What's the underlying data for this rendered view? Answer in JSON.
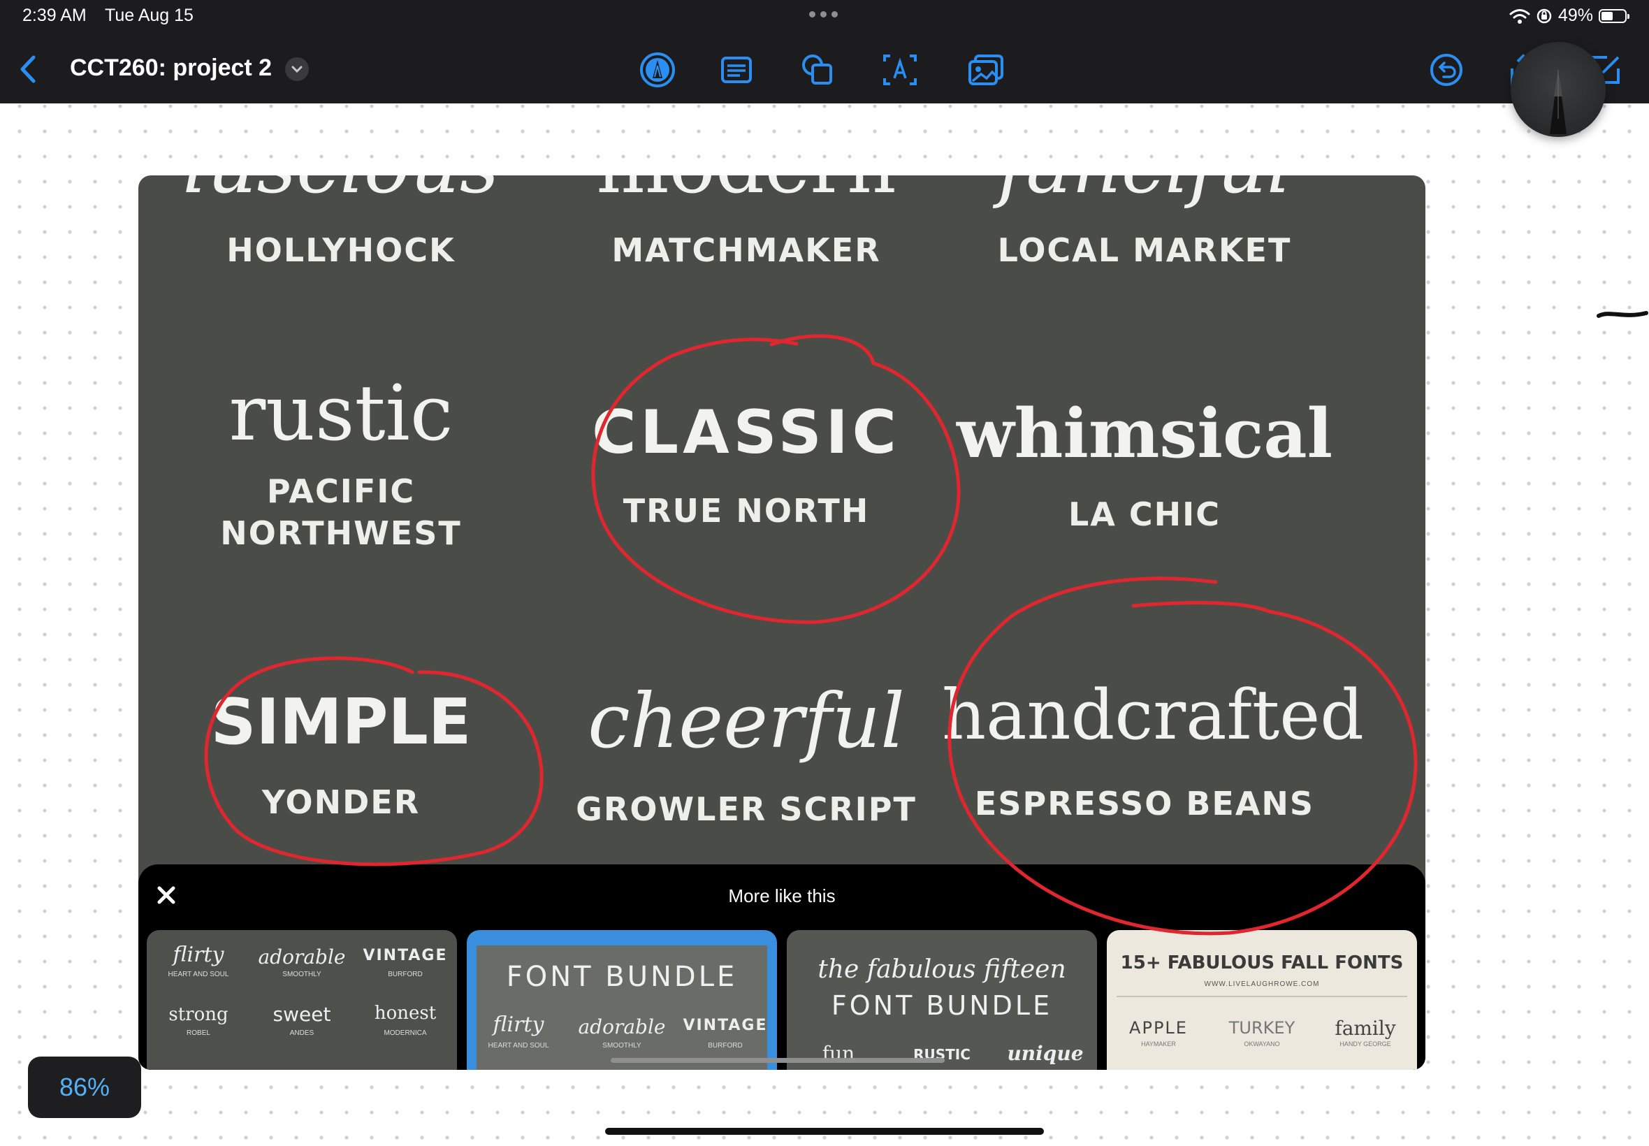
{
  "status_bar": {
    "time": "2:39 AM",
    "date": "Tue Aug 15",
    "battery": "49%",
    "battery_level": 0.49
  },
  "toolbar": {
    "title": "CCT260: project 2",
    "tools": [
      "pen-tool-icon",
      "text-box-icon",
      "shapes-icon",
      "text-recognition-icon",
      "insert-image-icon"
    ],
    "accent": "#2a8ef2"
  },
  "image": {
    "top_row": [
      {
        "script": "luscious",
        "font": "HOLLYHOCK"
      },
      {
        "script": "modern",
        "font": "MATCHMAKER"
      },
      {
        "script": "fanciful",
        "font": "LOCAL MARKET"
      }
    ],
    "middle_row": [
      {
        "display": "rustic",
        "font_line1": "PACIFIC",
        "font_line2": "NORTHWEST"
      },
      {
        "display": "CLASSIC",
        "font": "TRUE NORTH"
      },
      {
        "display": "whimsical",
        "font": "LA CHIC"
      }
    ],
    "bottom_row": [
      {
        "display": "SIMPLE",
        "font": "YONDER"
      },
      {
        "display": "cheerful",
        "font": "GROWLER SCRIPT"
      },
      {
        "display": "handcrafted",
        "font": "ESPRESSO BEANS"
      }
    ],
    "annotation_color": "#e0262f",
    "more": {
      "title": "More like this",
      "card1": {
        "w1": "flirty",
        "s1": "HEART AND SOUL",
        "w2": "adorable",
        "s2": "SMOOTHLY",
        "w3": "VINTAGE",
        "s3": "BURFORD",
        "w4": "strong",
        "s4": "ROBEL",
        "w5": "sweet",
        "s5": "ANDES",
        "w6": "honest",
        "s6": "MODERNICA"
      },
      "card2": {
        "title": "FONT BUNDLE",
        "w1": "flirty",
        "s1": "HEART AND SOUL",
        "w2": "adorable",
        "s2": "SMOOTHLY",
        "w3": "VINTAGE",
        "s3": "BURFORD"
      },
      "card3": {
        "line1": "the fabulous fifteen",
        "line2": "FONT BUNDLE",
        "w1": "fun",
        "w2": "RUSTIC",
        "w3": "unique"
      },
      "card4": {
        "title": "15+ FABULOUS FALL FONTS",
        "url": "WWW.LIVELAUGHROWE.COM",
        "w1": "APPLE",
        "s1": "HAYMAKER",
        "w2": "TURKEY",
        "s2": "OKWAYANO",
        "w3": "family",
        "s3": "HANDY GEORGE"
      }
    }
  },
  "zoom": "86%"
}
